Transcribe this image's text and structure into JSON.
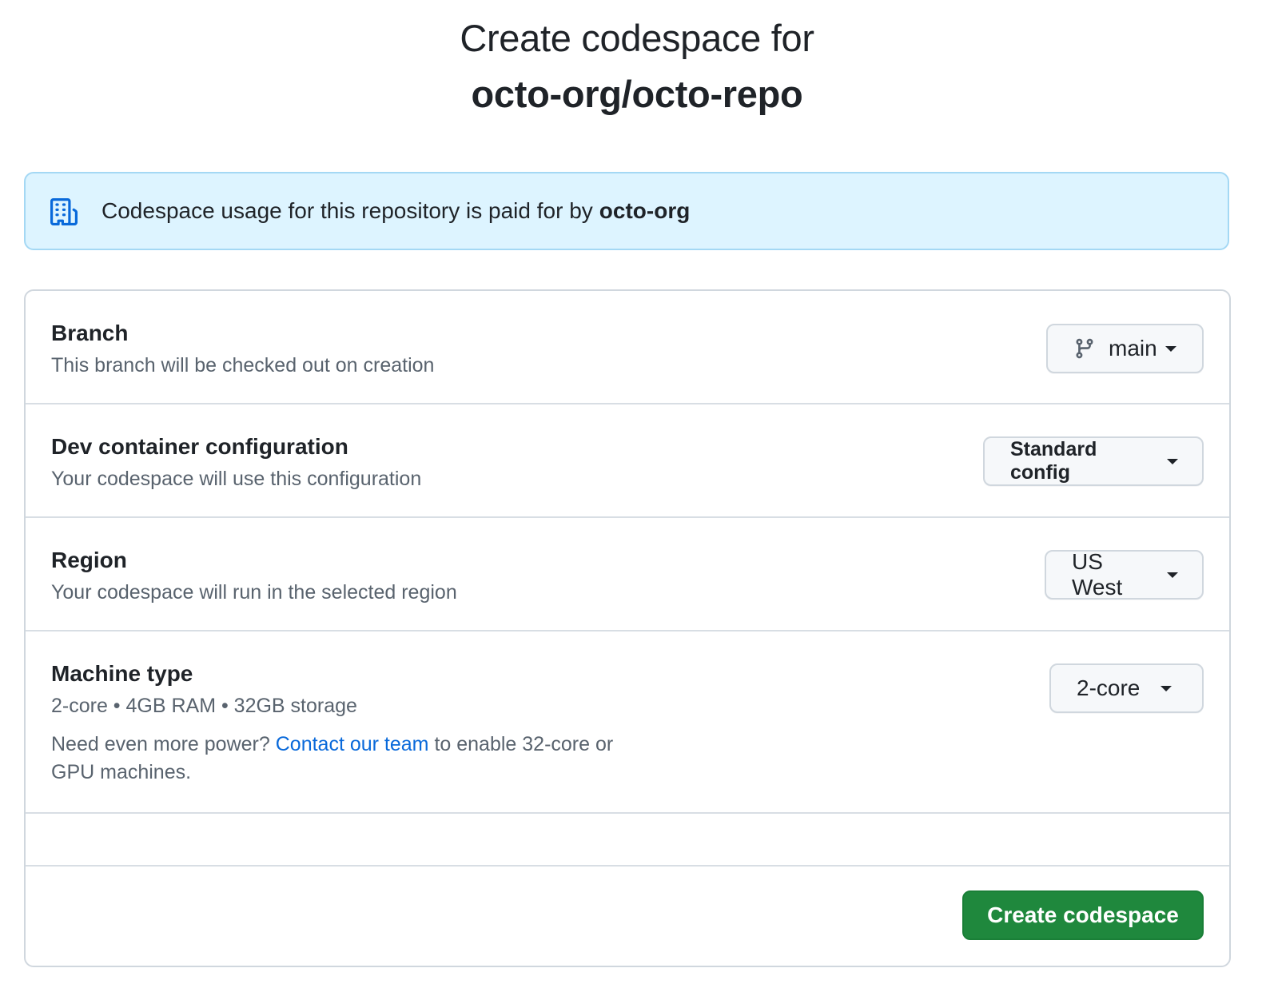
{
  "header": {
    "title_line1": "Create codespace for",
    "title_line2": "octo-org/octo-repo"
  },
  "banner": {
    "icon": "organization-icon",
    "text": "Codespace usage for this repository is paid for by",
    "org": "octo-org",
    "background_color": "#ddf4ff",
    "icon_color": "#0969da"
  },
  "branch": {
    "title": "Branch",
    "description": "This branch will be checked out on creation",
    "selected": "main",
    "icon": "git-branch-icon"
  },
  "dev_container": {
    "title": "Dev container configuration",
    "description": "Your codespace will use this configuration",
    "selected": "Standard config"
  },
  "region": {
    "title": "Region",
    "description": "Your codespace will run in the selected region",
    "selected": "US West"
  },
  "machine": {
    "title": "Machine type",
    "description": "2-core • 4GB RAM • 32GB storage",
    "extra_before": "Need even more power?",
    "extra_link": "Contact our team",
    "extra_after": "to enable 32-core or GPU machines.",
    "selected": "2-core",
    "link_color": "#0969da"
  },
  "footer": {
    "create_label": "Create codespace",
    "button_color": "#1f883d"
  }
}
